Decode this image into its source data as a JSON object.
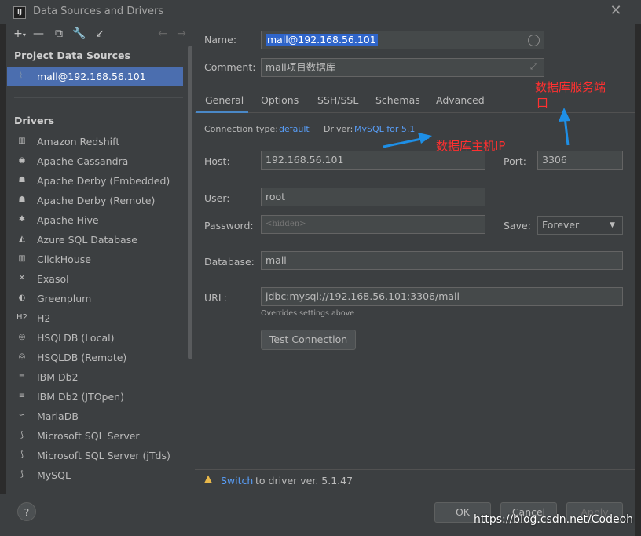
{
  "window": {
    "title": "Data Sources and Drivers",
    "app_icon": "IJ"
  },
  "left": {
    "project_sources_heading": "Project Data Sources",
    "selected_source": "mall@192.168.56.101",
    "drivers_heading": "Drivers",
    "drivers": [
      {
        "label": "Amazon Redshift",
        "icon": "redshift-icon"
      },
      {
        "label": "Apache Cassandra",
        "icon": "eye-icon"
      },
      {
        "label": "Apache Derby (Embedded)",
        "icon": "hat-icon"
      },
      {
        "label": "Apache Derby (Remote)",
        "icon": "hat-icon"
      },
      {
        "label": "Apache Hive",
        "icon": "bee-icon"
      },
      {
        "label": "Azure SQL Database",
        "icon": "triangle-icon"
      },
      {
        "label": "ClickHouse",
        "icon": "bars-icon"
      },
      {
        "label": "Exasol",
        "icon": "x-icon"
      },
      {
        "label": "Greenplum",
        "icon": "circle-icon"
      },
      {
        "label": "H2",
        "icon": "h2-icon"
      },
      {
        "label": "HSQLDB (Local)",
        "icon": "spiral-icon"
      },
      {
        "label": "HSQLDB (Remote)",
        "icon": "spiral-icon"
      },
      {
        "label": "IBM Db2",
        "icon": "ibm-icon"
      },
      {
        "label": "IBM Db2 (JTOpen)",
        "icon": "ibm-icon"
      },
      {
        "label": "MariaDB",
        "icon": "seal-icon"
      },
      {
        "label": "Microsoft SQL Server",
        "icon": "mssql-icon"
      },
      {
        "label": "Microsoft SQL Server (jTds)",
        "icon": "mssql-icon"
      },
      {
        "label": "MySQL",
        "icon": "dolphin-icon"
      }
    ]
  },
  "form": {
    "name_label": "Name:",
    "name_value": "mall@192.168.56.101",
    "comment_label": "Comment:",
    "comment_value": "mall项目数据库",
    "tabs": [
      "General",
      "Options",
      "SSH/SSL",
      "Schemas",
      "Advanced"
    ],
    "conn_type_label": "Connection type:",
    "conn_type_value": "default",
    "driver_label": "Driver:",
    "driver_value": "MySQL for 5.1",
    "host_label": "Host:",
    "host_value": "192.168.56.101",
    "port_label": "Port:",
    "port_value": "3306",
    "user_label": "User:",
    "user_value": "root",
    "password_label": "Password:",
    "password_value": "<hidden>",
    "save_label": "Save:",
    "save_value": "Forever",
    "database_label": "Database:",
    "database_value": "mall",
    "url_label": "URL:",
    "url_value": "jdbc:mysql://192.168.56.101:3306/mall",
    "url_hint": "Overrides settings above",
    "test_button": "Test Connection"
  },
  "annotations": {
    "port_note_line1": "数据库服务端",
    "port_note_line2": "口",
    "host_note": "数据库主机IP",
    "arrow_color": "#1e8fe6",
    "text_color": "#ff3030"
  },
  "status": {
    "warning_icon": "warning-icon",
    "switch_link": "Switch",
    "message": " to driver ver. 5.1.47"
  },
  "footer": {
    "help": "?",
    "ok": "OK",
    "cancel": "Cancel",
    "apply": "Apply",
    "watermark": "https://blog.csdn.net/Codeoh"
  }
}
